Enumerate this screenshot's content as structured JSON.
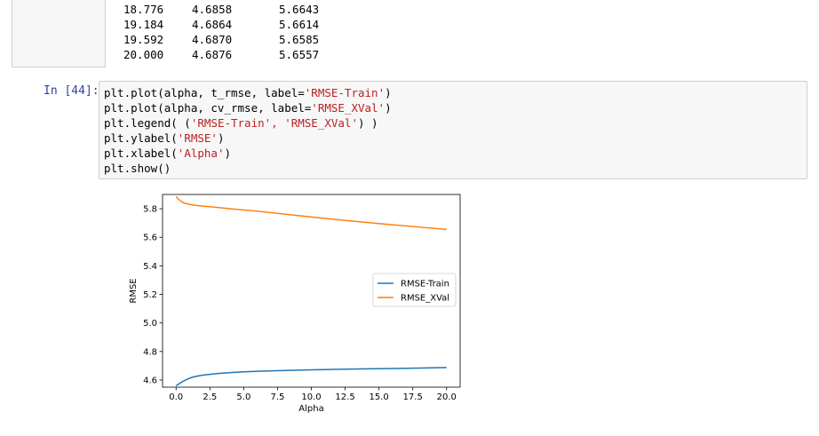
{
  "previous_output": {
    "rows": [
      [
        "18.776",
        "4.6858",
        "5.6643"
      ],
      [
        "19.184",
        "4.6864",
        "5.6614"
      ],
      [
        "19.592",
        "4.6870",
        "5.6585"
      ],
      [
        "20.000",
        "4.6876",
        "5.6557"
      ]
    ]
  },
  "cell": {
    "prompt": "In [44]:",
    "lines": [
      {
        "pre": "plt.plot(alpha, t_rmse, label=",
        "str": "'RMSE-Train'",
        "post": ")"
      },
      {
        "pre": "plt.plot(alpha, cv_rmse, label=",
        "str": "'RMSE_XVal'",
        "post": ")"
      },
      {
        "pre": "plt.legend( (",
        "str": "'RMSE-Train', 'RMSE_XVal'",
        "post": ") )"
      },
      {
        "pre": "plt.ylabel(",
        "str": "'RMSE'",
        "post": ")"
      },
      {
        "pre": "plt.xlabel(",
        "str": "'Alpha'",
        "post": ")"
      },
      {
        "pre": "plt.show()",
        "str": "",
        "post": ""
      }
    ]
  },
  "chart_data": {
    "type": "line",
    "xlabel": "Alpha",
    "ylabel": "RMSE",
    "xlim": [
      -1.0,
      21.0
    ],
    "ylim": [
      4.55,
      5.9
    ],
    "xticks": [
      0.0,
      2.5,
      5.0,
      7.5,
      10.0,
      12.5,
      15.0,
      17.5,
      20.0
    ],
    "xtick_labels": [
      "0.0",
      "2.5",
      "5.0",
      "7.5",
      "10.0",
      "12.5",
      "15.0",
      "17.5",
      "20.0"
    ],
    "yticks": [
      4.6,
      4.8,
      5.0,
      5.2,
      5.4,
      5.6,
      5.8
    ],
    "ytick_labels": [
      "4.6",
      "4.8",
      "5.0",
      "5.2",
      "5.4",
      "5.6",
      "5.8"
    ],
    "grid": false,
    "legend_position": "center-right",
    "series": [
      {
        "name": "RMSE-Train",
        "color": "#1f77b4",
        "x": [
          0.0,
          0.4,
          0.8,
          1.2,
          1.6,
          2.0,
          3.0,
          4.0,
          5.0,
          6.0,
          8.0,
          10.0,
          12.0,
          14.0,
          16.0,
          18.0,
          20.0
        ],
        "y": [
          4.56,
          4.585,
          4.605,
          4.62,
          4.628,
          4.635,
          4.645,
          4.652,
          4.657,
          4.661,
          4.667,
          4.671,
          4.675,
          4.678,
          4.681,
          4.684,
          4.688
        ]
      },
      {
        "name": "RMSE_XVal",
        "color": "#ff7f0e",
        "x": [
          0.0,
          0.2,
          0.4,
          0.6,
          0.8,
          1.0,
          1.5,
          2.0,
          3.0,
          4.0,
          6.0,
          8.0,
          10.0,
          12.0,
          14.0,
          16.0,
          18.0,
          20.0
        ],
        "y": [
          5.885,
          5.865,
          5.85,
          5.84,
          5.835,
          5.83,
          5.823,
          5.818,
          5.81,
          5.8,
          5.783,
          5.762,
          5.742,
          5.723,
          5.705,
          5.688,
          5.671,
          5.655
        ]
      }
    ]
  }
}
